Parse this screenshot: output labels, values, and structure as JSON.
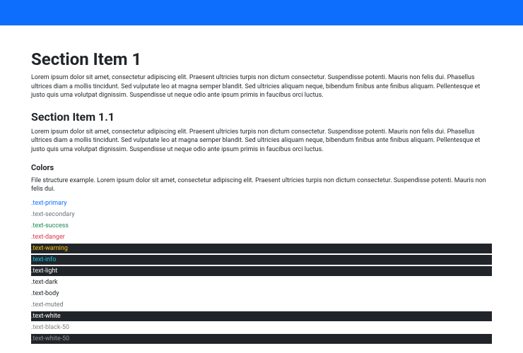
{
  "section1": {
    "title": "Section Item 1",
    "body": "Lorem ipsum dolor sit amet, consectetur adipiscing elit. Praesent ultricies turpis non dictum consectetur. Suspendisse potenti. Mauris non felis dui. Phasellus ultrices diam a mollis tincidunt. Sed vulputate leo at magna semper blandit. Sed ultricies aliquam neque, bibendum finibus ante finibus aliquam. Pellentesque et justo quis urna volutpat dignissim. Suspendisse ut neque odio ante ipsum primis in faucibus orci luctus."
  },
  "section11": {
    "title": "Section Item 1.1",
    "body": "Lorem ipsum dolor sit amet, consectetur adipiscing elit. Praesent ultricies turpis non dictum consectetur. Suspendisse potenti. Mauris non felis dui. Phasellus ultrices diam a mollis tincidunt. Sed vulputate leo at magna semper blandit. Sed ultricies aliquam neque, bibendum finibus ante finibus aliquam. Pellentesque et justo quis urna volutpat dignissim. Suspendisse ut neque odio ante ipsum primis in faucibus orci luctus."
  },
  "colors": {
    "title": "Colors",
    "intro": "File structure example. Lorem ipsum dolor sit amet, consectetur adipiscing elit. Praesent ultricies turpis non dictum consectetur. Suspendisse potenti. Mauris non felis dui.",
    "swatches": {
      "primary": ".text-primary",
      "secondary": ".text-secondary",
      "success": ".text-success",
      "danger": ".text-danger",
      "warning": ".text-warning",
      "info": ".text-info",
      "light": ".text-light",
      "dark": ".text-dark",
      "body": ".text-body",
      "muted": ".text-muted",
      "white": ".text-white",
      "black50": ".text-black-50",
      "white50": ".text-white-50"
    }
  }
}
